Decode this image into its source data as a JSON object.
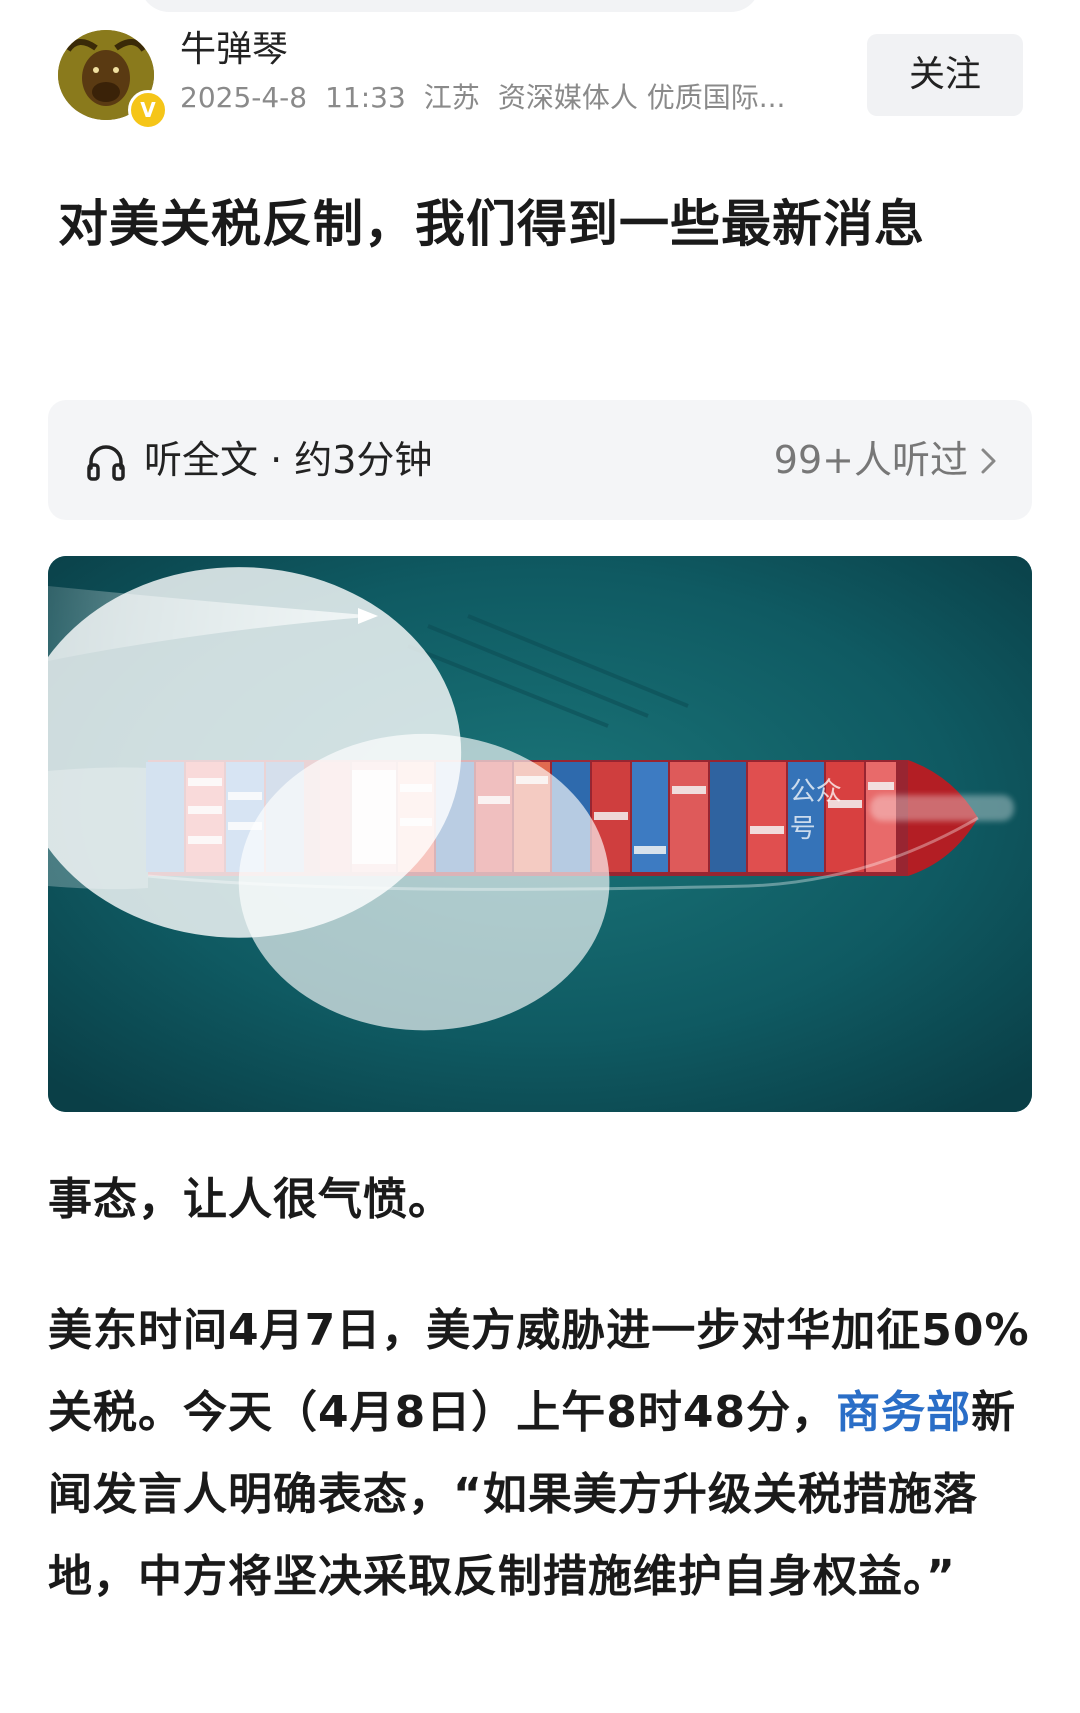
{
  "author": {
    "name": "牛弹琴",
    "verify_badge": "V",
    "meta": {
      "date": "2025-4-8",
      "time": "11:33",
      "location": "江苏",
      "tags": "资深媒体人 优质国际..."
    },
    "follow_label": "关注"
  },
  "article": {
    "title": "对美关税反制，我们得到一些最新消息"
  },
  "listen": {
    "label": "听全文 · 约3分钟",
    "count": "99+人听过"
  },
  "hero": {
    "watermark_label": "公众号"
  },
  "body": {
    "para1": "事态，让人很气愤。",
    "para2_part1": "美东时间4月7日，美方威胁进一步对华加征50%关税。今天（4月8日）上午8时48分，",
    "para2_link": "商务部",
    "para2_part2": "新闻发言人明确表态，“如果美方升级关税措施落地，中方将坚决采取反制措施维护自身权益。”"
  },
  "colors": {
    "link": "#2a6ec7",
    "badge": "#f5c518",
    "sea": "#0f5560"
  }
}
